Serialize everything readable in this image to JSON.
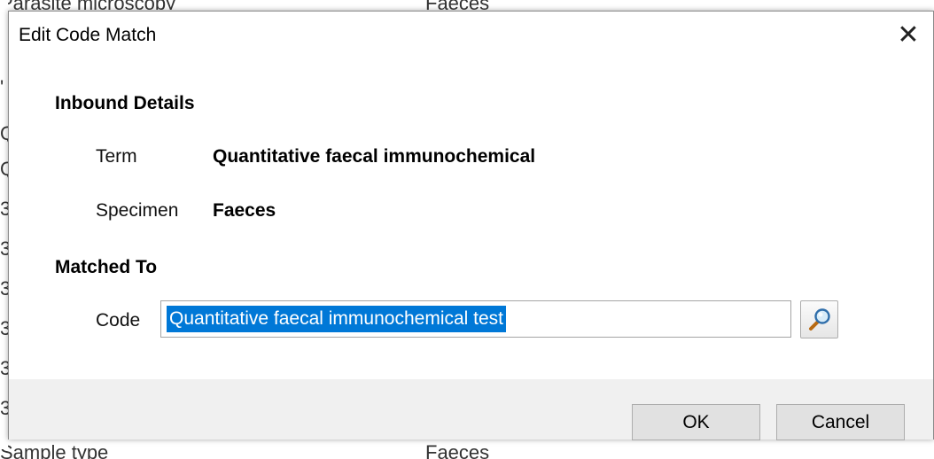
{
  "background": {
    "top_left_text": "Parasite microscopy",
    "top_right_text": "Faeces",
    "bottom_left_text": "Sample type",
    "bottom_right_text": "Faeces",
    "edge_glyphs": [
      "'",
      "Q",
      "Q",
      "3",
      "3",
      "3",
      "3",
      "3",
      "3"
    ]
  },
  "dialog": {
    "title": "Edit Code Match",
    "close_symbol": "✕",
    "inbound": {
      "heading": "Inbound Details",
      "term_label": "Term",
      "term_value": "Quantitative faecal immunochemical",
      "specimen_label": "Specimen",
      "specimen_value": "Faeces"
    },
    "matched": {
      "heading": "Matched To",
      "code_label": "Code",
      "code_value": "Quantitative faecal immunochemical test",
      "lookup_icon": "magnifier-icon"
    },
    "buttons": {
      "ok": "OK",
      "cancel": "Cancel"
    }
  },
  "colors": {
    "selection": "#0078d7",
    "footer": "#f0f0f0",
    "button_face": "#e1e1e1"
  }
}
